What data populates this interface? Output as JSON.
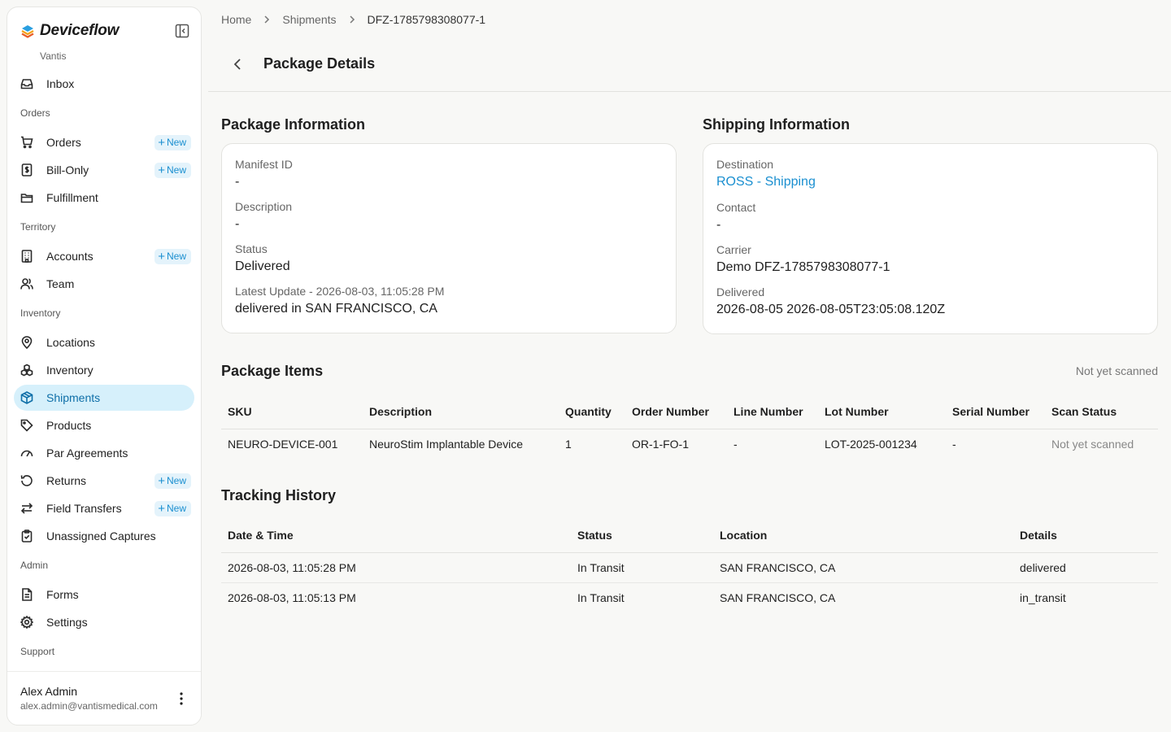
{
  "brand": {
    "name": "Deviceflow",
    "org": "Vantis"
  },
  "sidebar": {
    "inbox": "Inbox",
    "sections": {
      "orders": "Orders",
      "territory": "Territory",
      "inventory": "Inventory",
      "admin": "Admin",
      "support": "Support"
    },
    "items": {
      "orders": "Orders",
      "bill_only": "Bill-Only",
      "fulfillment": "Fulfillment",
      "accounts": "Accounts",
      "team": "Team",
      "locations": "Locations",
      "inventory": "Inventory",
      "shipments": "Shipments",
      "products": "Products",
      "par_agreements": "Par Agreements",
      "returns": "Returns",
      "field_transfers": "Field Transfers",
      "unassigned_captures": "Unassigned Captures",
      "forms": "Forms",
      "settings": "Settings"
    },
    "new_badge": "New",
    "active_item": "Shipments"
  },
  "user": {
    "name": "Alex Admin",
    "email": "alex.admin@vantismedical.com"
  },
  "breadcrumb": [
    "Home",
    "Shipments",
    "DFZ-1785798308077-1"
  ],
  "page_title": "Package Details",
  "package_info": {
    "title": "Package Information",
    "manifest_label": "Manifest ID",
    "manifest_value": "-",
    "description_label": "Description",
    "description_value": "-",
    "status_label": "Status",
    "status_value": "Delivered",
    "latest_update_label": "Latest Update - 2026-08-03, 11:05:28 PM",
    "latest_update_value": "delivered in SAN FRANCISCO, CA"
  },
  "shipping_info": {
    "title": "Shipping Information",
    "destination_label": "Destination",
    "destination_value": "ROSS - Shipping",
    "contact_label": "Contact",
    "contact_value": "-",
    "carrier_label": "Carrier",
    "carrier_value": "Demo DFZ-1785798308077-1",
    "delivered_label": "Delivered",
    "delivered_value": "2026-08-05 2026-08-05T23:05:08.120Z"
  },
  "package_items": {
    "title": "Package Items",
    "scan_summary": "Not yet scanned",
    "columns": [
      "SKU",
      "Description",
      "Quantity",
      "Order Number",
      "Line Number",
      "Lot Number",
      "Serial Number",
      "Scan Status"
    ],
    "rows": [
      [
        "NEURO-DEVICE-001",
        "NeuroStim Implantable Device",
        "1",
        "OR-1-FO-1",
        "-",
        "LOT-2025-001234",
        "-",
        "Not yet scanned"
      ]
    ]
  },
  "tracking": {
    "title": "Tracking History",
    "columns": [
      "Date & Time",
      "Status",
      "Location",
      "Details"
    ],
    "rows": [
      [
        "2026-08-03, 11:05:28 PM",
        "In Transit",
        "SAN FRANCISCO, CA",
        "delivered"
      ],
      [
        "2026-08-03, 11:05:13 PM",
        "In Transit",
        "SAN FRANCISCO, CA",
        "in_transit"
      ]
    ]
  },
  "colors": {
    "accent": "#1a8fd0",
    "active_bg": "#d6f0fb",
    "background": "#f8f8f6"
  }
}
